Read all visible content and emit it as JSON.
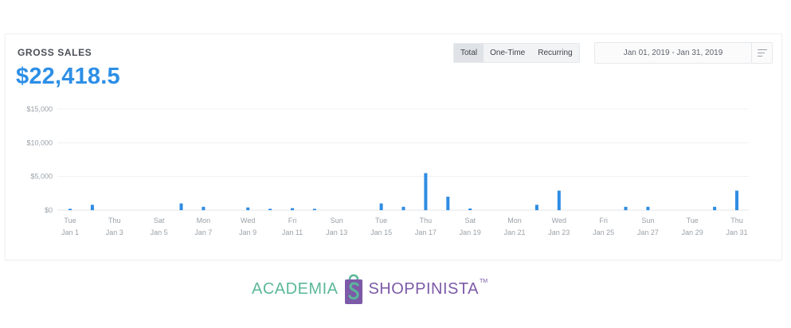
{
  "card": {
    "title": "GROSS SALES",
    "total": "$22,418.5"
  },
  "tabs": [
    {
      "label": "Total",
      "active": true
    },
    {
      "label": "One-Time",
      "active": false
    },
    {
      "label": "Recurring",
      "active": false
    }
  ],
  "date_range": {
    "value": "Jan 01, 2019  -  Jan 31, 2019",
    "menu_icon": "lines-icon"
  },
  "colors": {
    "accent": "#2d8fe6",
    "bar": "#2e8ce3",
    "logo_green": "#5bb89a",
    "logo_purple": "#7c5aa8"
  },
  "logo": {
    "left": "ACADEMIA",
    "right": "SHOPPINISTA",
    "tm": "TM",
    "mark_icon": "shopping-bag-s-icon"
  },
  "chart_data": {
    "type": "bar",
    "title": "",
    "ylim": [
      0,
      15000
    ],
    "yticks": [
      {
        "value": 0,
        "label": "$0"
      },
      {
        "value": 5000,
        "label": "$5,000"
      },
      {
        "value": 10000,
        "label": "$10,000"
      },
      {
        "value": 15000,
        "label": "$15,000"
      }
    ],
    "xticks": [
      {
        "day": 1,
        "weekday": "Tue",
        "date": "Jan 1"
      },
      {
        "day": 3,
        "weekday": "Thu",
        "date": "Jan 3"
      },
      {
        "day": 5,
        "weekday": "Sat",
        "date": "Jan 5"
      },
      {
        "day": 7,
        "weekday": "Mon",
        "date": "Jan 7"
      },
      {
        "day": 9,
        "weekday": "Wed",
        "date": "Jan 9"
      },
      {
        "day": 11,
        "weekday": "Fri",
        "date": "Jan 11"
      },
      {
        "day": 13,
        "weekday": "Sun",
        "date": "Jan 13"
      },
      {
        "day": 15,
        "weekday": "Tue",
        "date": "Jan 15"
      },
      {
        "day": 17,
        "weekday": "Thu",
        "date": "Jan 17"
      },
      {
        "day": 19,
        "weekday": "Sat",
        "date": "Jan 19"
      },
      {
        "day": 21,
        "weekday": "Mon",
        "date": "Jan 21"
      },
      {
        "day": 23,
        "weekday": "Wed",
        "date": "Jan 23"
      },
      {
        "day": 25,
        "weekday": "Fri",
        "date": "Jan 25"
      },
      {
        "day": 27,
        "weekday": "Sun",
        "date": "Jan 27"
      },
      {
        "day": 29,
        "weekday": "Tue",
        "date": "Jan 29"
      },
      {
        "day": 31,
        "weekday": "Thu",
        "date": "Jan 31"
      }
    ],
    "categories": [
      "Jan 1",
      "Jan 2",
      "Jan 3",
      "Jan 4",
      "Jan 5",
      "Jan 6",
      "Jan 7",
      "Jan 8",
      "Jan 9",
      "Jan 10",
      "Jan 11",
      "Jan 12",
      "Jan 13",
      "Jan 14",
      "Jan 15",
      "Jan 16",
      "Jan 17",
      "Jan 18",
      "Jan 19",
      "Jan 20",
      "Jan 21",
      "Jan 22",
      "Jan 23",
      "Jan 24",
      "Jan 25",
      "Jan 26",
      "Jan 27",
      "Jan 28",
      "Jan 29",
      "Jan 30",
      "Jan 31"
    ],
    "values": [
      200,
      800,
      0,
      0,
      0,
      1000,
      500,
      0,
      400,
      200,
      300,
      200,
      0,
      0,
      1000,
      500,
      5500,
      2000,
      250,
      0,
      0,
      800,
      2900,
      0,
      0,
      500,
      500,
      0,
      0,
      500,
      2900
    ],
    "grid": true,
    "legend": "none"
  }
}
